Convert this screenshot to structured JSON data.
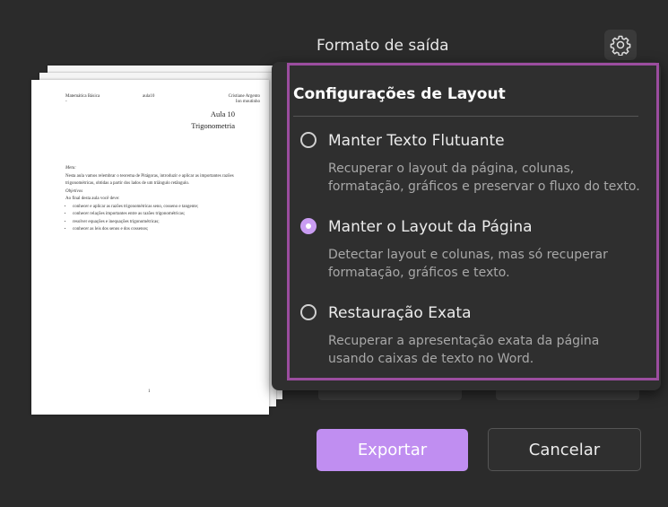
{
  "header": {
    "output_format_label": "Formato de saída",
    "settings_icon": "gear-icon"
  },
  "preview": {
    "header_left": "Matemática Básica",
    "header_left_dot": "-",
    "header_mid": "aula10",
    "header_right": "Cristiane Argento",
    "header_right2": "Ion moutinho",
    "aula": "Aula 10",
    "subject": "Trigonometria",
    "meta_label": "Meta:",
    "meta_text": "Nesta aula vamos relembrar o teorema de Pitágoras, introduzir e aplicar as importantes razões trigonométricas, obtidas a partir dos lados de um triângulo retângulo.",
    "objectives_label": "Objetivos",
    "objectives_intro": "Ao final desta aula você deve:",
    "objectives": [
      "conhecer e aplicar as razões trigonométricas seno, cosseno e tangente;",
      "conhecer relações importantes entre as razões trigonométricas;",
      "resolver equações e inequações trigonométricas;",
      "conhecer as leis dos senos e dos cossenos;"
    ],
    "page_number": "1"
  },
  "layout_settings": {
    "title": "Configurações de Layout",
    "options": [
      {
        "label": "Manter Texto Flutuante",
        "description": "Recuperar o layout da página, colunas, formatação, gráficos e preservar o fluxo do texto.",
        "selected": false
      },
      {
        "label": "Manter o Layout da Página",
        "description": "Detectar layout e colunas, mas só recuperar formatação, gráficos e texto.",
        "selected": true
      },
      {
        "label": "Restauração Exata",
        "description": "Recuperar a apresentação exata da página usando caixas de texto no Word.",
        "selected": false
      }
    ]
  },
  "footer": {
    "export_label": "Exportar",
    "cancel_label": "Cancelar"
  },
  "colors": {
    "background": "#2b2b2b",
    "accent": "#c08ef1",
    "highlight_border": "#9b4d9f"
  }
}
